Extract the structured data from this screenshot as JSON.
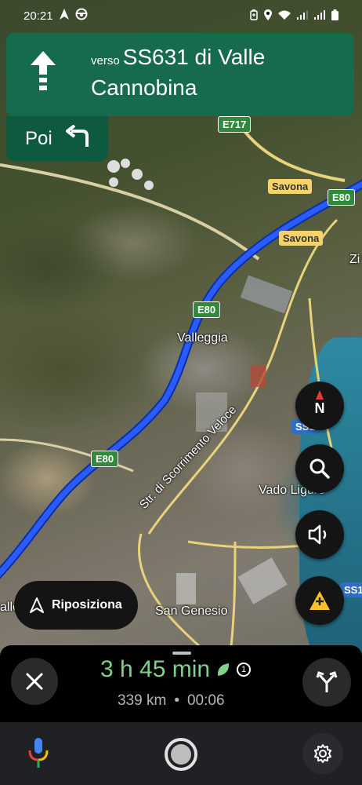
{
  "status_bar": {
    "time": "20:21",
    "icons_left": [
      "navigation-arrow-icon",
      "steering-wheel-icon"
    ],
    "icons_right": [
      "battery-saver-icon",
      "location-icon",
      "wifi-icon",
      "signal-icon",
      "signal-icon-2",
      "battery-icon"
    ]
  },
  "navigation": {
    "maneuver_icon": "straight-arrow-icon",
    "prefix": "verso",
    "road_line1": "SS631 di Valle",
    "road_line2": "Cannobina",
    "then_label": "Poi",
    "then_icon": "turn-left-icon",
    "banner_color": "#176b4d"
  },
  "map": {
    "shields": {
      "e717": "E717",
      "e80_a": "E80",
      "e80_b": "E80",
      "e80_c": "E80",
      "savona_a": "Savona",
      "savona_b": "Savona",
      "ss1_a": "SS1",
      "ss1_b": "SS1"
    },
    "labels": {
      "valleggia": "Valleggia",
      "vado": "Vado Ligure",
      "san_genesio": "San Genesio",
      "street": "Str. di Scorrimento Veloce",
      "zi": "Zi",
      "alle": "alle"
    },
    "route_color": "#2a5bff"
  },
  "map_controls": {
    "compass_label": "N",
    "search_icon": "search-icon",
    "sound_icon": "volume-icon",
    "report_icon": "report-incident-icon"
  },
  "recenter": {
    "label": "Riposiziona"
  },
  "trip": {
    "duration": "3 h 45 min",
    "eco_icon": "leaf-icon",
    "badge": "1",
    "distance": "339 km",
    "separator": "•",
    "arrival": "00:06"
  },
  "system_nav": {
    "assistant_icon": "microphone-icon",
    "home_icon": "home-button-icon",
    "settings_icon": "gear-icon"
  }
}
